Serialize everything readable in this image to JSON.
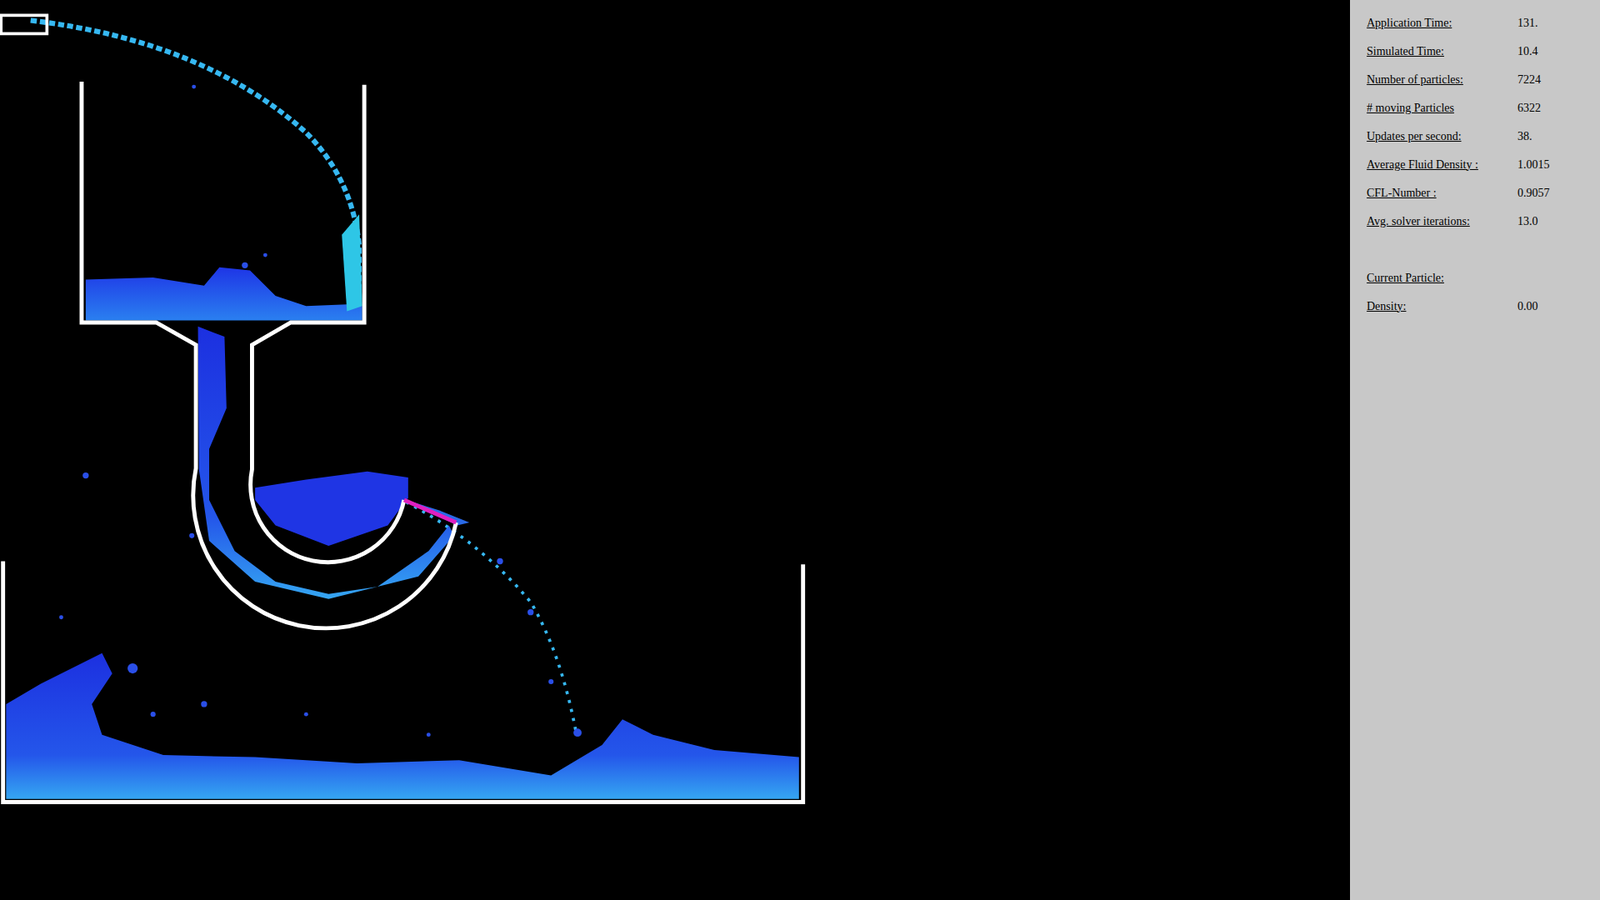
{
  "stats": [
    {
      "label": "Application Time:",
      "value": "131."
    },
    {
      "label": "Simulated Time:",
      "value": "10.4"
    },
    {
      "label": "Number of particles:",
      "value": "7224"
    },
    {
      "label": "# moving Particles",
      "value": "6322"
    },
    {
      "label": "Updates per second:",
      "value": "38."
    },
    {
      "label": "Average Fluid Density :",
      "value": "1.0015"
    },
    {
      "label": "CFL-Number :",
      "value": "0.9057"
    },
    {
      "label": "Avg. solver iterations:",
      "value": "13.0"
    }
  ],
  "current_particle": {
    "heading": "Current Particle:",
    "rows": [
      {
        "label": "Density:",
        "value": "0.00"
      }
    ]
  }
}
